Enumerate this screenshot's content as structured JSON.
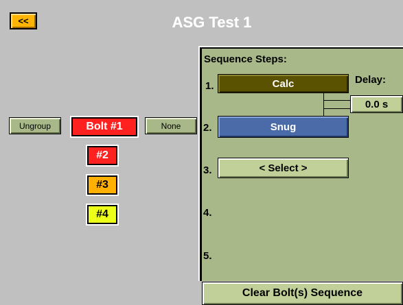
{
  "header": {
    "back_label": "<<",
    "title": "ASG Test 1"
  },
  "grouping": {
    "ungroup_label": "Ungroup",
    "none_label": "None"
  },
  "bolts": [
    {
      "label": "Bolt #1",
      "color": "#ff2020"
    },
    {
      "label": "#2",
      "color": "#ff2020"
    },
    {
      "label": "#3",
      "color": "#ffb000"
    },
    {
      "label": "#4",
      "color": "#ecff18"
    }
  ],
  "sequence": {
    "title": "Sequence Steps:",
    "delay_label": "Delay:",
    "delay_value": "0.0 s",
    "step_numbers": [
      "1.",
      "2.",
      "3.",
      "4.",
      "5."
    ],
    "steps": [
      {
        "label": "Calc",
        "color": "#5a5200"
      },
      {
        "label": "Snug",
        "color": "#4a6aa8"
      },
      {
        "label": "< Select >",
        "color": "#c0d098"
      }
    ],
    "clear_label": "Clear Bolt(s) Sequence"
  }
}
